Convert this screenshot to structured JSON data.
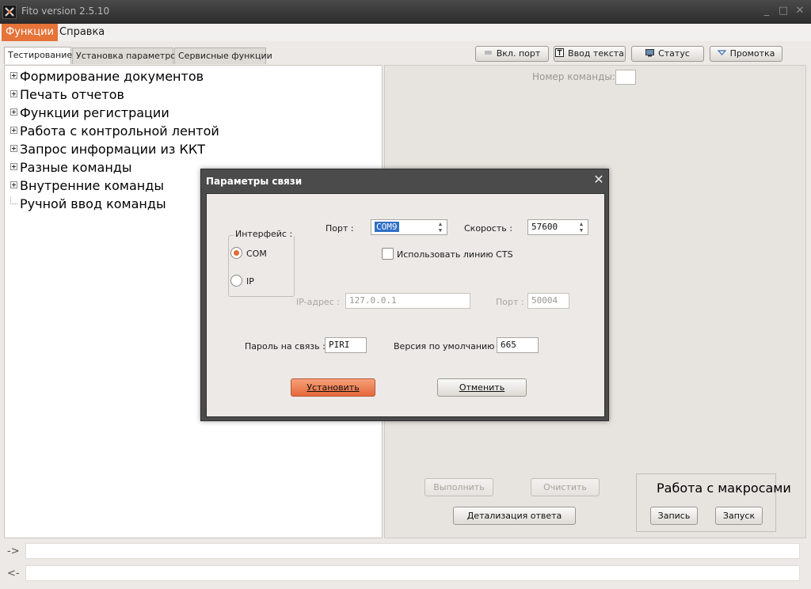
{
  "window": {
    "title": "Fito version 2.5.10",
    "minimize": "_",
    "maximize": "□",
    "close": "✕"
  },
  "menu": {
    "items": [
      "Функции",
      "Справка"
    ]
  },
  "tabs": [
    "Тестирование",
    "Установка параметров",
    "Сервисные функции"
  ],
  "toolbar": {
    "port_on": "Вкл. порт",
    "text_input": "Ввод текста",
    "status": "Статус",
    "feed": "Промотка"
  },
  "tree": {
    "items": [
      "Формирование документов",
      "Печать отчетов",
      "Функции регистрации",
      "Работа с контрольной лентой",
      "Запрос информации из ККТ",
      "Разные команды",
      "Внутренние команды",
      "Ручной ввод команды"
    ]
  },
  "right": {
    "command_number_label": "Номер команды:",
    "command_number_value": "",
    "execute": "Выполнить",
    "clear": "Очистить",
    "details": "Детализация ответа",
    "macros_title": "Работа с макросами",
    "record": "Запись",
    "run": "Запуск"
  },
  "io": {
    "out_arrow": "->",
    "in_arrow": "<-",
    "out_value": "",
    "in_value": ""
  },
  "dialog": {
    "title": "Параметры связи",
    "close": "✕",
    "interface_label": "Интерфейс :",
    "com": "COM",
    "ip": "IP",
    "interface_selected": "COM",
    "port_label": "Порт :",
    "port_value": "COM9",
    "speed_label": "Скорость :",
    "speed_value": "57600",
    "use_cts": "Использовать линию CTS",
    "use_cts_checked": false,
    "ip_address_label": "IP-адрес :",
    "ip_address_value": "127.0.0.1",
    "ip_port_label": "Порт :",
    "ip_port_value": "50004",
    "password_label": "Пароль на связь :",
    "password_value": "PIRI",
    "version_label": "Версия по умолчанию :",
    "version_value": "665",
    "ok": "Установить",
    "cancel": "Отменить"
  },
  "colors": {
    "accent": "#e67338",
    "titlebar": "#2b2b2b",
    "selection": "#2f6fc7"
  }
}
